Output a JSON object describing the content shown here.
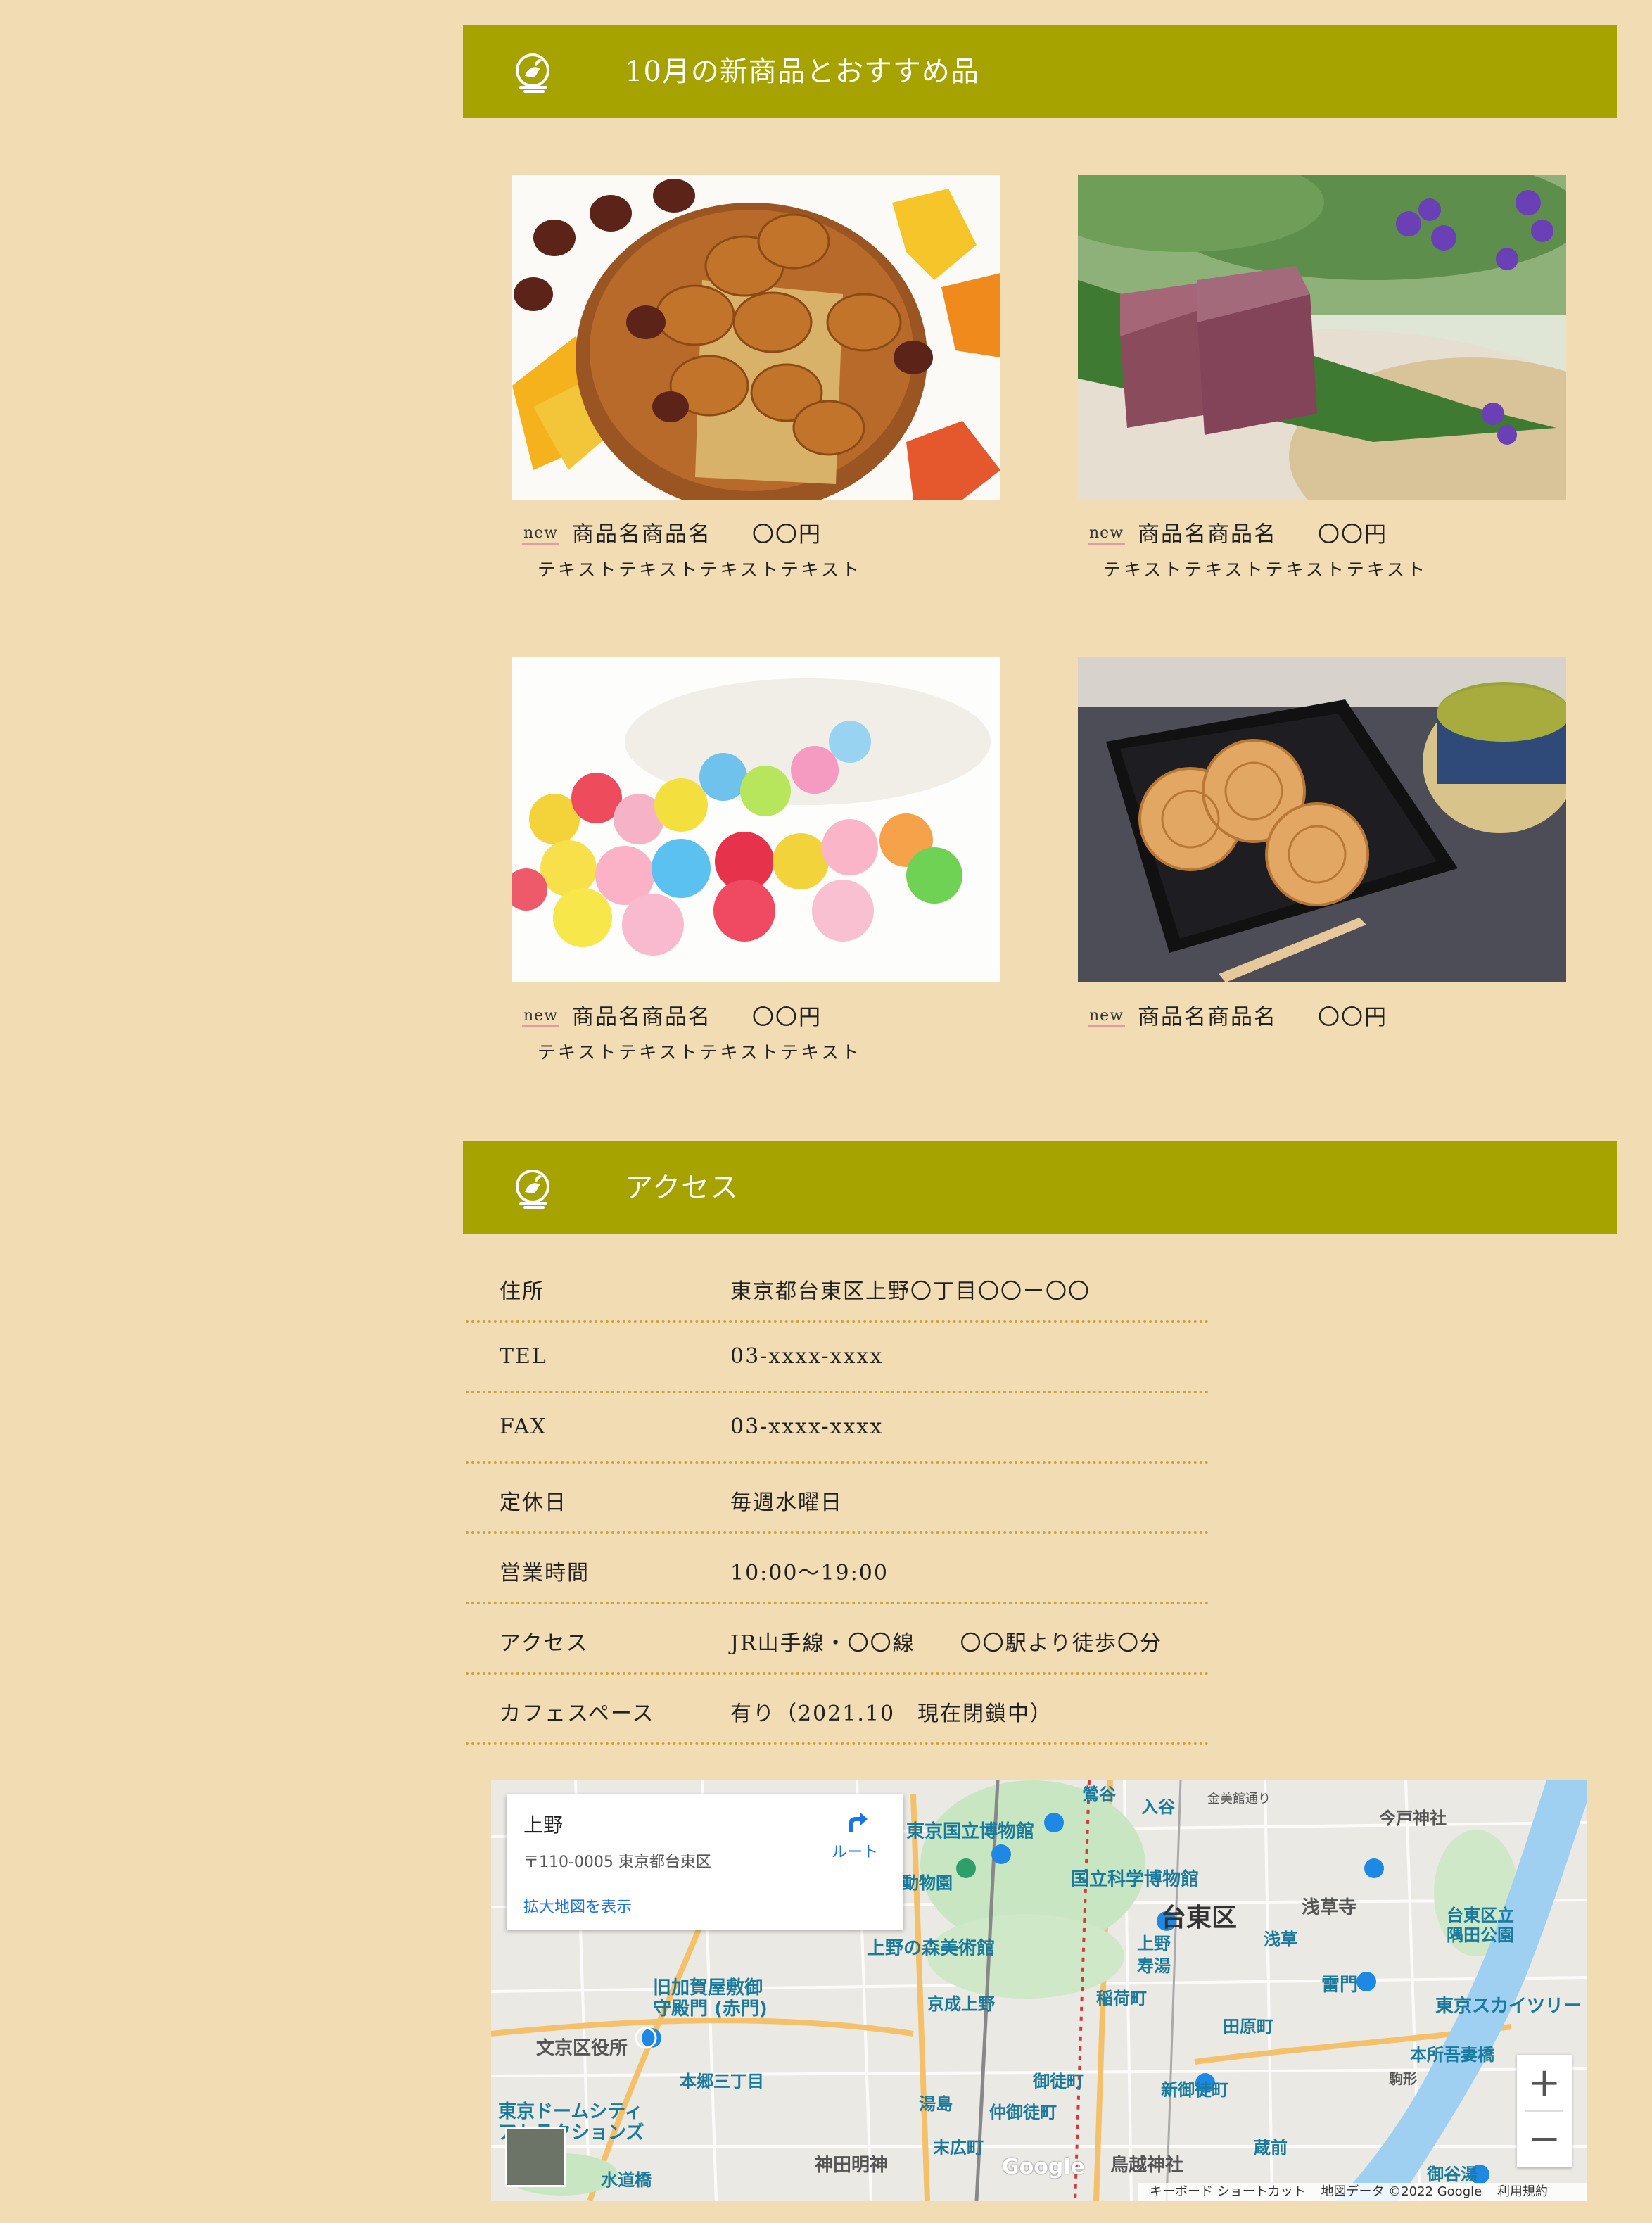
{
  "sections": {
    "new_products": {
      "title": "10月の新商品とおすすめ品"
    },
    "access": {
      "title": "アクセス"
    }
  },
  "products": [
    {
      "badge": "new",
      "name": "商品名商品名",
      "price": "〇〇円",
      "description": "テキストテキストテキストテキスト",
      "image": "autumn-manju-chestnuts-photo"
    },
    {
      "badge": "new",
      "name": "商品名商品名",
      "price": "〇〇円",
      "description": "テキストテキストテキストテキスト",
      "image": "yokan-on-leaf-photo"
    },
    {
      "badge": "new",
      "name": "商品名商品名",
      "price": "〇〇円",
      "description": "テキストテキストテキストテキスト",
      "image": "colorful-candy-photo"
    },
    {
      "badge": "new",
      "name": "商品名商品名",
      "price": "〇〇円",
      "description": "",
      "image": "monaka-and-tea-photo"
    }
  ],
  "access_table": [
    {
      "label": "住所",
      "value": "東京都台東区上野〇丁目〇〇ー〇〇"
    },
    {
      "label": "TEL",
      "value": "03-xxxx-xxxx"
    },
    {
      "label": "FAX",
      "value": "03-xxxx-xxxx"
    },
    {
      "label": "定休日",
      "value": "毎週水曜日"
    },
    {
      "label": "営業時間",
      "value": "10:00〜19:00"
    },
    {
      "label": "アクセス",
      "value": "JR山手線・〇〇線　　〇〇駅より徒歩〇分"
    },
    {
      "label": "カフェスペース",
      "value": "有り（2021.10　現在閉鎖中）"
    }
  ],
  "map": {
    "place_name": "上野",
    "address": "〒110-0005 東京都台東区",
    "route_label": "ルート",
    "enlarge_link": "拡大地図を表示",
    "labels": {
      "taito": "台東区",
      "tnm": "東京国立博物館",
      "science": "国立科学博物館",
      "ueno_forest": "上野の森美術館",
      "kyu_kaga": "旧加賀屋敷御",
      "akamon": "守殿門 (赤門)",
      "keisei_ueno": "京成上野",
      "bunkyo": "文京区役所",
      "hongo": "本郷三丁目",
      "dome": "東京ドームシティ",
      "attractions": "アトラクションズ",
      "suidobashi": "水道橋",
      "yushima": "湯島",
      "okachimachi": "御徒町",
      "naka_okachimachi": "仲御徒町",
      "shin_okachimachi": "新御徒町",
      "suehirocho": "末広町",
      "kanda_myojin": "神田明神",
      "torikoe": "鳥越神社",
      "kuramae": "蔵前",
      "inaricho": "稲荷町",
      "tawaramachi": "田原町",
      "kaminarimon": "雷門",
      "asakusa": "浅草",
      "asakusa_temple": "浅草寺",
      "sumida_park": "台東区立",
      "sumida_park2": "隅田公園",
      "skytree": "東京スカイツリー",
      "honjo": "本所吾妻橋",
      "imado": "今戸神社",
      "iriya": "入谷",
      "uguisudani": "鶯谷",
      "kotobuki": "寿湯",
      "ueno_station": "上野",
      "gokokuji_hall": "御谷湯",
      "komagata": "駒形",
      "zoo": "動物園",
      "kanasugi": "金美館通り"
    },
    "keyboard": "キーボード ショートカット",
    "map_data": "地図データ ©2022 Google",
    "terms": "利用規約",
    "google": "Google",
    "zoom_in": "+",
    "zoom_out": "−"
  }
}
